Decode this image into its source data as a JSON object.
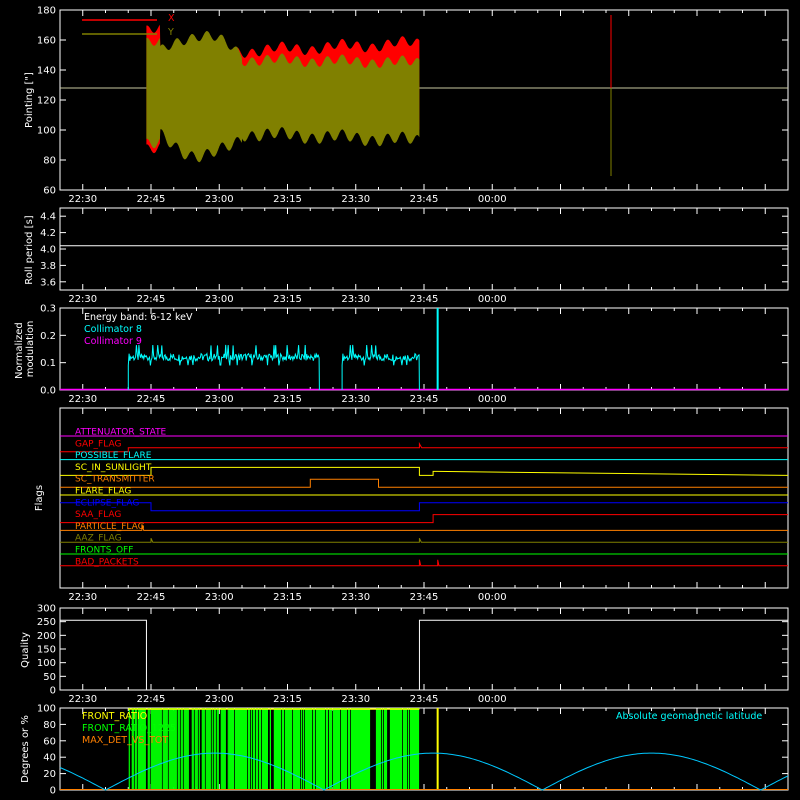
{
  "time_ticks": [
    "22:30",
    "22:45",
    "23:00",
    "23:15",
    "23:30",
    "23:45",
    "00:00"
  ],
  "chart_data": [
    {
      "type": "line",
      "ylabel": "Pointing [\"]",
      "ylim": [
        60,
        180
      ],
      "yticks": [
        60,
        80,
        100,
        120,
        140,
        160,
        180
      ],
      "xlim_minutes": [
        -5,
        155
      ],
      "legend": "top-left",
      "series": [
        {
          "name": "X",
          "color": "#ff0000",
          "data_start": "22:44",
          "data_end": "23:44",
          "baseline": 128
        },
        {
          "name": "Y",
          "color": "#808000",
          "data_start": "22:44",
          "data_end": "23:44",
          "baseline": 128
        }
      ]
    },
    {
      "type": "line",
      "ylabel": "Roll period [s]",
      "ylim": [
        3.5,
        4.5
      ],
      "yticks": [
        3.6,
        3.8,
        4.0,
        4.2,
        4.4
      ],
      "series": [
        {
          "name": "roll period",
          "color": "#ffffff",
          "value": 4.04
        }
      ]
    },
    {
      "type": "line",
      "ylabel": "Normalized modulation",
      "ylim": [
        0,
        0.3
      ],
      "yticks": [
        0.0,
        0.1,
        0.2,
        0.3
      ],
      "annotation": "Energy band: 6-12 keV",
      "legend": "top-left",
      "series": [
        {
          "name": "Collimator 8",
          "color": "#00ffff",
          "segments": [
            [
              "22:40",
              "23:22",
              0.12
            ],
            [
              "23:27",
              "23:44",
              0.12
            ]
          ],
          "spike": [
            "23:48",
            0.3
          ]
        },
        {
          "name": "Collimator 9",
          "color": "#ff00ff",
          "value": 0.0
        }
      ]
    },
    {
      "type": "line",
      "ylabel": "Flags",
      "flags": [
        {
          "name": "ATTENUATOR_STATE",
          "color": "#ff00ff"
        },
        {
          "name": "GAP_FLAG",
          "color": "#ff0000"
        },
        {
          "name": "POSSIBLE_FLARE",
          "color": "#00ffff"
        },
        {
          "name": "SC_IN_SUNLIGHT",
          "color": "#ffff00"
        },
        {
          "name": "SC_TRANSMITTER",
          "color": "#ff8000"
        },
        {
          "name": "FLARE_FLAG",
          "color": "#ffff00"
        },
        {
          "name": "ECLIPSE_FLAG",
          "color": "#0000ff"
        },
        {
          "name": "SAA_FLAG",
          "color": "#ff0000"
        },
        {
          "name": "PARTICLE_FLAG",
          "color": "#ff8000"
        },
        {
          "name": "AAZ_FLAG",
          "color": "#808000"
        },
        {
          "name": "FRONTS_OFF",
          "color": "#00ff00"
        },
        {
          "name": "BAD_PACKETS",
          "color": "#ff0000"
        }
      ]
    },
    {
      "type": "line",
      "ylabel": "Quality",
      "ylim": [
        0,
        300
      ],
      "yticks": [
        0,
        50,
        100,
        150,
        200,
        250,
        300
      ],
      "series": [
        {
          "name": "quality",
          "color": "#ffffff",
          "high": 255,
          "low": 0,
          "low_start": "22:44",
          "low_end": "23:44"
        }
      ]
    },
    {
      "type": "line",
      "ylabel": "Degrees or %",
      "ylim": [
        0,
        100
      ],
      "yticks": [
        0,
        20,
        40,
        60,
        80,
        100
      ],
      "legend": "top-left",
      "series": [
        {
          "name": "FRONT_RATIO",
          "color": "#ffff00"
        },
        {
          "name": "FRONT_RATIO_1225",
          "color": "#00ff00",
          "data_start": "22:40",
          "data_end": "23:44",
          "level": 100
        },
        {
          "name": "MAX_DET_VS_TOT",
          "color": "#ff8000"
        },
        {
          "name": "Absolute geomagnetic latitude",
          "color": "#00c8ff",
          "amplitude": 45
        }
      ]
    }
  ]
}
